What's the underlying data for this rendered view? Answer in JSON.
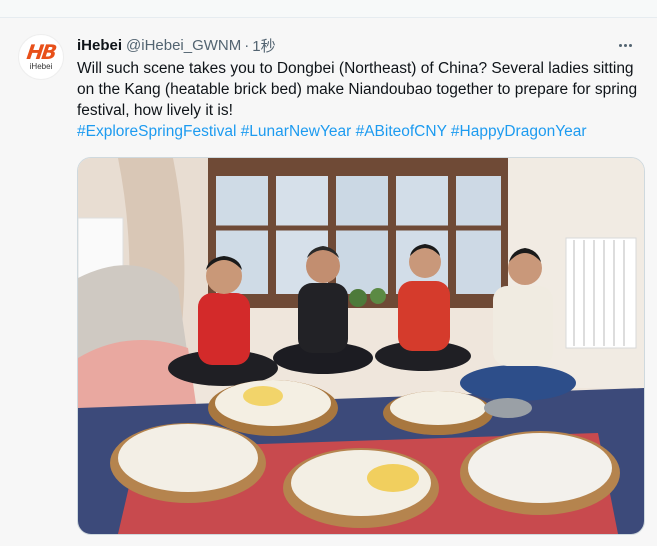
{
  "tweet": {
    "display_name": "iHebei",
    "handle": "@iHebei_GWNM",
    "separator": "·",
    "time": "1秒",
    "avatar_logo_text": "iHebei",
    "body": "Will such scene takes you to Dongbei (Northeast) of China?  Several ladies sitting on the Kang (heatable brick bed) make Niandoubao together to prepare for spring festival, how lively it is!",
    "hashtags": "#ExploreSpringFestival #LunarNewYear #ABiteofCNY #HappyDragonYear"
  },
  "colors": {
    "link": "#1d9bf0",
    "brand_orange": "#e8501a"
  },
  "icons": {
    "more": "more-horizontal-icon"
  }
}
